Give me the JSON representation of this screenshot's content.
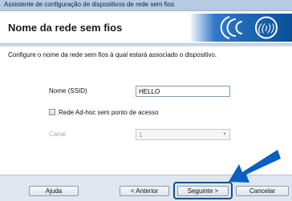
{
  "window": {
    "title": "Assistente de configuração de dispositivos de rede sem fios"
  },
  "header": {
    "title": "Nome da rede sem fios",
    "wifi_icon": "wifi-signal-icon"
  },
  "main": {
    "instruction": "Configure o nome da rede sem fios à qual estará associado o dispositivo.",
    "ssid": {
      "label": "Nome (SSID)",
      "value": "HELLO"
    },
    "adhoc": {
      "label": "Rede Ad-hoc sem ponto de acesso",
      "checked": false
    },
    "channel": {
      "label": "Canal",
      "value": "1",
      "disabled": true
    }
  },
  "footer": {
    "help_label": "Ajuda",
    "back_label": "< Anterior",
    "next_label": "Seguinte >",
    "cancel_label": "Cancelar"
  },
  "colors": {
    "accent": "#0a4f98",
    "title_bar": "#b6cbe2"
  }
}
